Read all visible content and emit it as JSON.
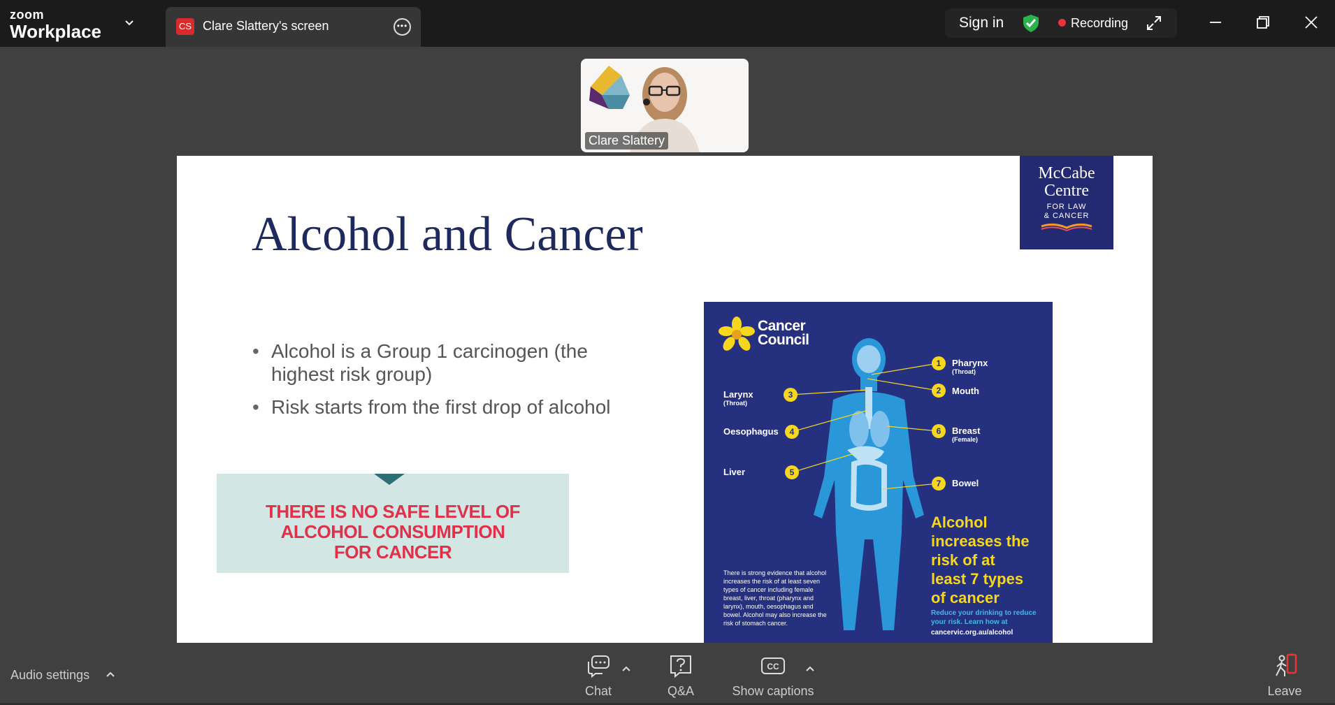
{
  "app": {
    "brand_small": "zoom",
    "brand_name": "Workplace"
  },
  "tab": {
    "badge": "CS",
    "title": "Clare Slattery's screen"
  },
  "status": {
    "sign_in": "Sign in",
    "recording": "Recording"
  },
  "video": {
    "participant_name": "Clare Slattery"
  },
  "slide": {
    "title": "Alcohol and Cancer",
    "logo_line1": "McCabe",
    "logo_line2": "Centre",
    "logo_line3": "FOR LAW",
    "logo_line4": "& CANCER",
    "bullets": [
      "Alcohol is a Group 1 carcinogen (the highest risk group)",
      "Risk starts from the first drop of alcohol"
    ],
    "banner_line1": "THERE IS NO SAFE LEVEL OF",
    "banner_line2": "ALCOHOL CONSUMPTION",
    "banner_line3": "FOR CANCER"
  },
  "poster": {
    "org_line1": "Cancer",
    "org_line2": "Council",
    "organs": [
      {
        "num": "1",
        "label": "Pharynx",
        "sub": "(Throat)"
      },
      {
        "num": "2",
        "label": "Mouth",
        "sub": ""
      },
      {
        "num": "3",
        "label": "Larynx",
        "sub": "(Throat)"
      },
      {
        "num": "4",
        "label": "Oesophagus",
        "sub": ""
      },
      {
        "num": "5",
        "label": "Liver",
        "sub": ""
      },
      {
        "num": "6",
        "label": "Breast",
        "sub": "(Female)"
      },
      {
        "num": "7",
        "label": "Bowel",
        "sub": ""
      }
    ],
    "headline_1": "Alcohol",
    "headline_2": "increases the",
    "headline_3": "risk of at",
    "headline_4": "least 7 types",
    "headline_5": "of cancer",
    "reduce_text": "Reduce your drinking to reduce your risk. Learn how at",
    "url": "cancervic.org.au/alcohol",
    "evidence_text": "There is strong evidence that alcohol increases the risk of at least seven types of cancer including female breast, liver, throat (pharynx and larynx), mouth, oesophagus and bowel. Alcohol may also increase the risk of stomach cancer.",
    "accent_yellow": "#f6d71d",
    "navy": "#25307f"
  },
  "toolbar": {
    "audio_settings": "Audio settings",
    "chat": "Chat",
    "qa": "Q&A",
    "captions": "Show captions",
    "leave": "Leave"
  },
  "icons": [
    "chevron-down-icon",
    "more-icon",
    "shield-check-icon",
    "expand-icon",
    "minimize-icon",
    "restore-icon",
    "close-icon",
    "chat-icon",
    "question-icon",
    "cc-icon",
    "leave-icon"
  ]
}
